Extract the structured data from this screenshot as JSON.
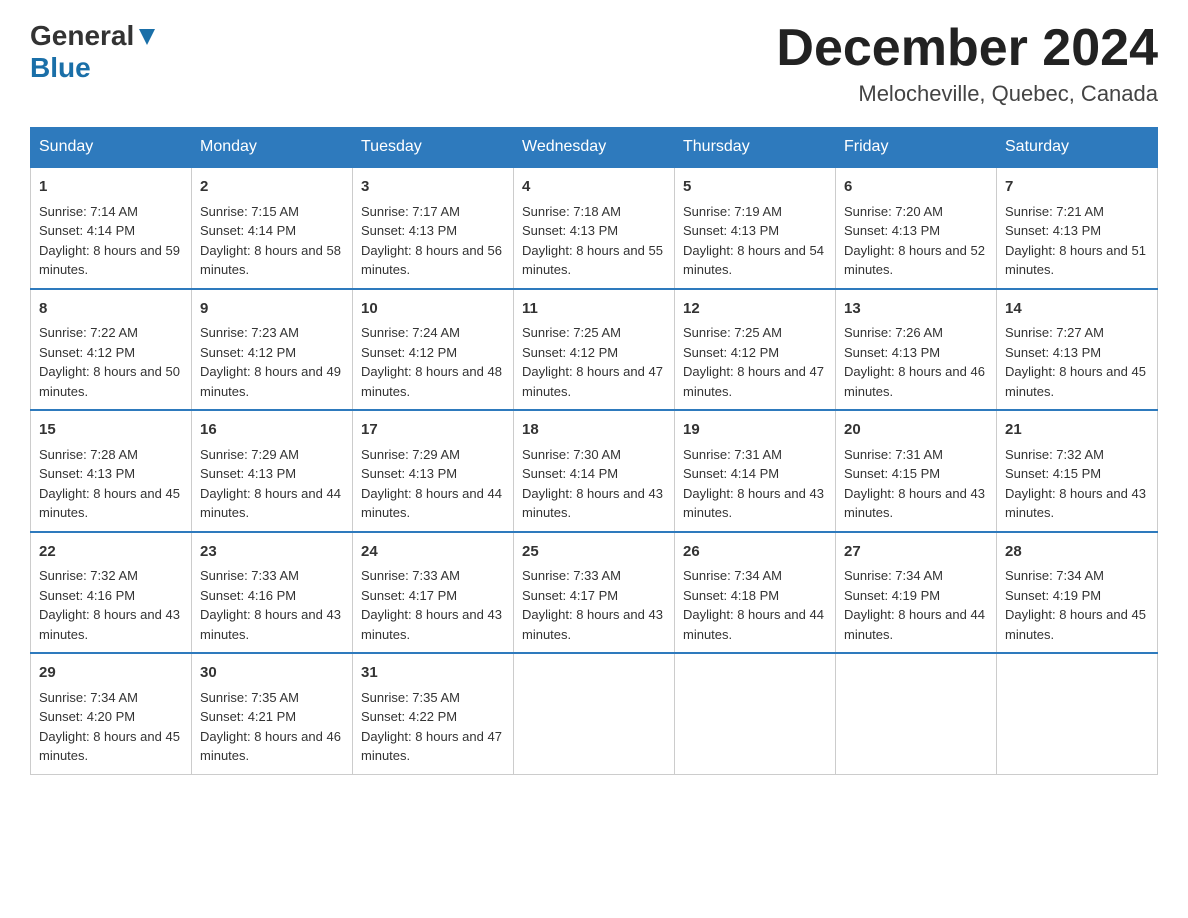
{
  "header": {
    "logo_general": "General",
    "logo_blue": "Blue",
    "month_title": "December 2024",
    "location": "Melocheville, Quebec, Canada"
  },
  "columns": [
    "Sunday",
    "Monday",
    "Tuesday",
    "Wednesday",
    "Thursday",
    "Friday",
    "Saturday"
  ],
  "weeks": [
    [
      {
        "day": "1",
        "sunrise": "7:14 AM",
        "sunset": "4:14 PM",
        "daylight": "8 hours and 59 minutes."
      },
      {
        "day": "2",
        "sunrise": "7:15 AM",
        "sunset": "4:14 PM",
        "daylight": "8 hours and 58 minutes."
      },
      {
        "day": "3",
        "sunrise": "7:17 AM",
        "sunset": "4:13 PM",
        "daylight": "8 hours and 56 minutes."
      },
      {
        "day": "4",
        "sunrise": "7:18 AM",
        "sunset": "4:13 PM",
        "daylight": "8 hours and 55 minutes."
      },
      {
        "day": "5",
        "sunrise": "7:19 AM",
        "sunset": "4:13 PM",
        "daylight": "8 hours and 54 minutes."
      },
      {
        "day": "6",
        "sunrise": "7:20 AM",
        "sunset": "4:13 PM",
        "daylight": "8 hours and 52 minutes."
      },
      {
        "day": "7",
        "sunrise": "7:21 AM",
        "sunset": "4:13 PM",
        "daylight": "8 hours and 51 minutes."
      }
    ],
    [
      {
        "day": "8",
        "sunrise": "7:22 AM",
        "sunset": "4:12 PM",
        "daylight": "8 hours and 50 minutes."
      },
      {
        "day": "9",
        "sunrise": "7:23 AM",
        "sunset": "4:12 PM",
        "daylight": "8 hours and 49 minutes."
      },
      {
        "day": "10",
        "sunrise": "7:24 AM",
        "sunset": "4:12 PM",
        "daylight": "8 hours and 48 minutes."
      },
      {
        "day": "11",
        "sunrise": "7:25 AM",
        "sunset": "4:12 PM",
        "daylight": "8 hours and 47 minutes."
      },
      {
        "day": "12",
        "sunrise": "7:25 AM",
        "sunset": "4:12 PM",
        "daylight": "8 hours and 47 minutes."
      },
      {
        "day": "13",
        "sunrise": "7:26 AM",
        "sunset": "4:13 PM",
        "daylight": "8 hours and 46 minutes."
      },
      {
        "day": "14",
        "sunrise": "7:27 AM",
        "sunset": "4:13 PM",
        "daylight": "8 hours and 45 minutes."
      }
    ],
    [
      {
        "day": "15",
        "sunrise": "7:28 AM",
        "sunset": "4:13 PM",
        "daylight": "8 hours and 45 minutes."
      },
      {
        "day": "16",
        "sunrise": "7:29 AM",
        "sunset": "4:13 PM",
        "daylight": "8 hours and 44 minutes."
      },
      {
        "day": "17",
        "sunrise": "7:29 AM",
        "sunset": "4:13 PM",
        "daylight": "8 hours and 44 minutes."
      },
      {
        "day": "18",
        "sunrise": "7:30 AM",
        "sunset": "4:14 PM",
        "daylight": "8 hours and 43 minutes."
      },
      {
        "day": "19",
        "sunrise": "7:31 AM",
        "sunset": "4:14 PM",
        "daylight": "8 hours and 43 minutes."
      },
      {
        "day": "20",
        "sunrise": "7:31 AM",
        "sunset": "4:15 PM",
        "daylight": "8 hours and 43 minutes."
      },
      {
        "day": "21",
        "sunrise": "7:32 AM",
        "sunset": "4:15 PM",
        "daylight": "8 hours and 43 minutes."
      }
    ],
    [
      {
        "day": "22",
        "sunrise": "7:32 AM",
        "sunset": "4:16 PM",
        "daylight": "8 hours and 43 minutes."
      },
      {
        "day": "23",
        "sunrise": "7:33 AM",
        "sunset": "4:16 PM",
        "daylight": "8 hours and 43 minutes."
      },
      {
        "day": "24",
        "sunrise": "7:33 AM",
        "sunset": "4:17 PM",
        "daylight": "8 hours and 43 minutes."
      },
      {
        "day": "25",
        "sunrise": "7:33 AM",
        "sunset": "4:17 PM",
        "daylight": "8 hours and 43 minutes."
      },
      {
        "day": "26",
        "sunrise": "7:34 AM",
        "sunset": "4:18 PM",
        "daylight": "8 hours and 44 minutes."
      },
      {
        "day": "27",
        "sunrise": "7:34 AM",
        "sunset": "4:19 PM",
        "daylight": "8 hours and 44 minutes."
      },
      {
        "day": "28",
        "sunrise": "7:34 AM",
        "sunset": "4:19 PM",
        "daylight": "8 hours and 45 minutes."
      }
    ],
    [
      {
        "day": "29",
        "sunrise": "7:34 AM",
        "sunset": "4:20 PM",
        "daylight": "8 hours and 45 minutes."
      },
      {
        "day": "30",
        "sunrise": "7:35 AM",
        "sunset": "4:21 PM",
        "daylight": "8 hours and 46 minutes."
      },
      {
        "day": "31",
        "sunrise": "7:35 AM",
        "sunset": "4:22 PM",
        "daylight": "8 hours and 47 minutes."
      },
      null,
      null,
      null,
      null
    ]
  ],
  "labels": {
    "sunrise_prefix": "Sunrise: ",
    "sunset_prefix": "Sunset: ",
    "daylight_prefix": "Daylight: "
  }
}
